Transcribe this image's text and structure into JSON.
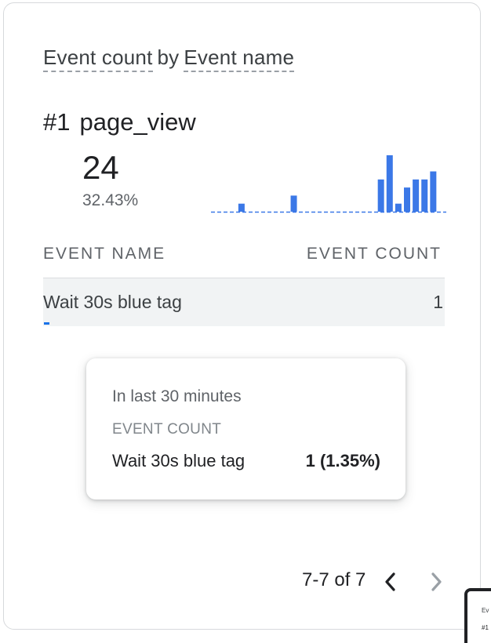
{
  "card": {
    "title_metric": "Event count",
    "title_by": "by",
    "title_dimension": "Event name"
  },
  "top_item": {
    "rank": "#1",
    "name": "page_view",
    "value": "24",
    "percent": "32.43%"
  },
  "chart_data": {
    "type": "bar",
    "title": "",
    "xlabel": "",
    "ylabel": "",
    "values": [
      0,
      0,
      0,
      1,
      0,
      0,
      0,
      0,
      0,
      2,
      0,
      0,
      0,
      0,
      0,
      0,
      0,
      0,
      0,
      4,
      7,
      1,
      3,
      4,
      4,
      5,
      0
    ],
    "ylim": [
      0,
      7
    ],
    "color": "#3b78e7"
  },
  "table": {
    "columns": [
      "EVENT NAME",
      "EVENT COUNT"
    ],
    "rows": [
      {
        "name": "Wait 30s blue tag",
        "count": "1",
        "share": 0.0135
      }
    ]
  },
  "tooltip": {
    "heading": "In last 30 minutes",
    "metric": "EVENT COUNT",
    "name": "Wait 30s blue tag",
    "value": "1 (1.35%)"
  },
  "pagination": {
    "label": "7-7 of 7",
    "prev_icon": "chevron-left-icon",
    "next_icon": "chevron-right-icon"
  },
  "thumbnail": {
    "line1": "Ev",
    "line2": "#1"
  },
  "colors": {
    "accent": "#1a73e8",
    "bar": "#3b78e7",
    "row_highlight": "#f1f3f4"
  }
}
